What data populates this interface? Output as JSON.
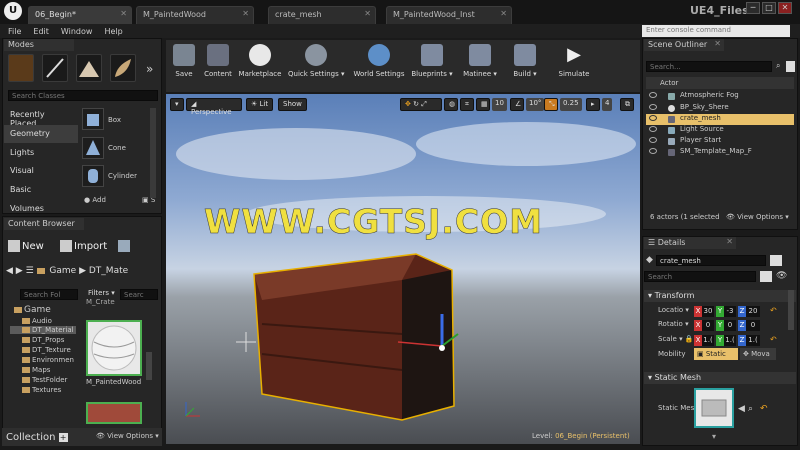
{
  "titlebar": {
    "logo": "U",
    "tabs": [
      {
        "label": "06_Begin*"
      },
      {
        "label": "M_PaintedWood"
      },
      {
        "label": "crate_mesh"
      },
      {
        "label": "M_PaintedWood_Inst"
      }
    ],
    "app_title": "UE4_Files",
    "min": "─",
    "max": "□",
    "close": "✕"
  },
  "menu": {
    "items": [
      {
        "label": "File"
      },
      {
        "label": "Edit"
      },
      {
        "label": "Window"
      },
      {
        "label": "Help"
      }
    ],
    "console_placeholder": "Enter console command"
  },
  "modes": {
    "title": "Modes",
    "search_placeholder": "Search Classes",
    "categories": [
      {
        "label": "Recently Placed"
      },
      {
        "label": "Geometry"
      },
      {
        "label": "Lights"
      },
      {
        "label": "Visual"
      },
      {
        "label": "Basic"
      },
      {
        "label": "Volumes"
      }
    ],
    "shapes": [
      {
        "label": "Box"
      },
      {
        "label": "Cone"
      },
      {
        "label": "Cylinder"
      }
    ],
    "add_label": "Add",
    "sub_label": "S",
    "more": "»"
  },
  "content_browser": {
    "title": "Content Browser",
    "new_label": "New",
    "import_label": "Import",
    "path": [
      "Game",
      "DT_Mate"
    ],
    "search_folders_placeholder": "Search Fol",
    "filters_label": "Filters",
    "search_assets_placeholder": "Searc",
    "folders": [
      {
        "label": "Game"
      },
      {
        "label": "Audio"
      },
      {
        "label": "DT_Material"
      },
      {
        "label": "DT_Props"
      },
      {
        "label": "DT_Texture"
      },
      {
        "label": "Environmen"
      },
      {
        "label": "Maps"
      },
      {
        "label": "TestFolder"
      },
      {
        "label": "Textures"
      }
    ],
    "asset_top_label": "M_Crate",
    "asset_label": "M_PaintedWood",
    "collection_label": "Collection",
    "view_options": "View Options"
  },
  "toolbar": {
    "buttons": [
      {
        "label": "Save"
      },
      {
        "label": "Content"
      },
      {
        "label": "Marketplace"
      },
      {
        "label": "Quick Settings"
      },
      {
        "label": "World Settings"
      },
      {
        "label": "Blueprints"
      },
      {
        "label": "Matinee"
      },
      {
        "label": "Build"
      },
      {
        "label": "Simulate"
      }
    ]
  },
  "viewport": {
    "perspective": "Perspective",
    "lit": "Lit",
    "show": "Show",
    "grid_snap": "10",
    "rot_snap": "10°",
    "scale_snap": "0.25",
    "cam_speed": "4",
    "watermark": "WWW.CGTSJ.COM",
    "level_label": "Level:",
    "level_name": "06_Begin (Persistent)"
  },
  "outliner": {
    "title": "Scene Outliner",
    "search_placeholder": "Search...",
    "column_header": "Actor",
    "items": [
      {
        "label": "Atmospheric Fog"
      },
      {
        "label": "BP_Sky_Shere"
      },
      {
        "label": "crate_mesh"
      },
      {
        "label": "Light Source"
      },
      {
        "label": "Player Start"
      },
      {
        "label": "SM_Template_Map_F"
      }
    ],
    "status": "6 actors (1 selected",
    "view_options": "View Options"
  },
  "details": {
    "title": "Details",
    "name_value": "crate_mesh",
    "search_placeholder": "Search",
    "transform_label": "Transform",
    "location_label": "Locatio",
    "rotation_label": "Rotatio",
    "scale_label": "Scale",
    "mobility_label": "Mobility",
    "location": {
      "x": "30",
      "y": "-3",
      "z": "20"
    },
    "rotation": {
      "x": "0",
      "y": "0",
      "z": "0"
    },
    "scale": {
      "x": "1.(",
      "y": "1.(",
      "z": "1.("
    },
    "static_label": "Static",
    "movable_label": "Mova",
    "static_mesh_section": "Static Mesh",
    "static_mesh_label": "Static Mes"
  },
  "colors": {
    "accent": "#e8c06a",
    "selected_row": "#e8c06a",
    "x_axis": "#c33",
    "y_axis": "#3a3",
    "z_axis": "#36c",
    "watermark": "#f0e040"
  }
}
